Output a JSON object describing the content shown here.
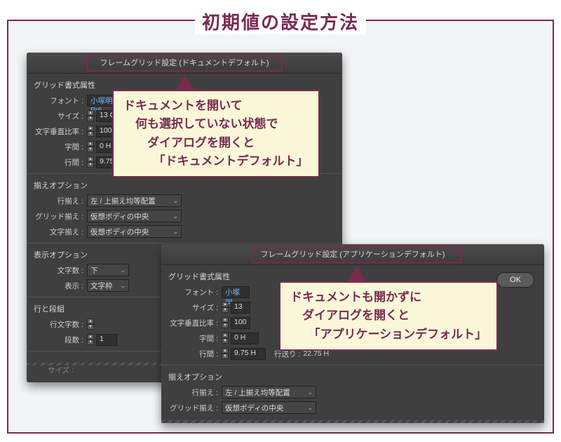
{
  "title": "初期値の設定方法",
  "dialog1": {
    "title": "フレームグリッド設定 (ドキュメントデフォルト)",
    "grid_attrs_heading": "グリッド書式属性",
    "font_label": "フォント :",
    "font_value": "小塚明朝 Pr6",
    "size_label": "サイズ :",
    "size_value": "13 Q",
    "vscale_label": "文字垂直比率 :",
    "vscale_value": "100%",
    "aki_label": "字間 :",
    "aki_value": "0 H",
    "line_gap_label": "行間 :",
    "line_gap_value": "9.75 H",
    "align_heading": "揃えオプション",
    "line_align_label": "行揃え :",
    "line_align_value": "左 / 上揃え均等配置",
    "grid_align_label": "グリッド揃え :",
    "grid_align_value": "仮想ボディの中央",
    "char_align_label": "文字揃え :",
    "char_align_value": "仮想ボディの中央",
    "view_heading": "表示オプション",
    "char_count_label": "文字数 :",
    "char_count_value": "下",
    "display_label": "表示 :",
    "display_value": "文字枠",
    "cols_heading": "行と段組",
    "line_chars_label": "行文字数 :",
    "num_cols_label": "段数 :",
    "num_cols_value": "1",
    "footer": "サイズ :"
  },
  "dialog2": {
    "title": "フレームグリッド設定 (アプリケーションデフォルト)",
    "ok": "OK",
    "grid_attrs_heading": "グリッド書式属性",
    "font_label": "フォント :",
    "font_value": "小塚明",
    "size_label": "サイズ :",
    "size_value": "13",
    "vscale_label": "文字垂直比率 :",
    "vscale_value": "100",
    "aki_label": "字間 :",
    "aki_value": "0 H",
    "line_gap_label": "行間 :",
    "line_gap_value": "9.75 H",
    "line_feed_label": "行送り :",
    "line_feed_value": "22.75 H",
    "align_heading": "揃えオプション",
    "line_align_label": "行揃え :",
    "line_align_value": "左 / 上揃え均等配置",
    "grid_align_label": "グリッド揃え :",
    "grid_align_value": "仮想ボディの中央"
  },
  "callout1": {
    "l1": "ドキュメントを開いて",
    "l2": "　何も選択していない状態で",
    "l3": "　　ダイアログを開くと",
    "l4": "　　　「ドキュメントデフォルト」"
  },
  "callout2": {
    "l1": "ドキュメントも開かずに",
    "l2": "　ダイアログを開くと",
    "l3": "　　「アプリケーションデフォルト」"
  }
}
